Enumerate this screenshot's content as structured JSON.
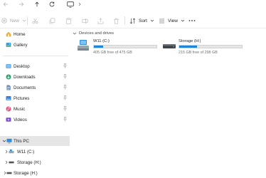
{
  "toolbar": {
    "new_label": "New",
    "sort_label": "Sort",
    "view_label": "View"
  },
  "sidebar": {
    "home": "Home",
    "gallery": "Gallery",
    "quick": [
      "Desktop",
      "Downloads",
      "Documents",
      "Pictures",
      "Music",
      "Videos"
    ],
    "this_pc": "This PC",
    "tree": [
      "W11 (C:)",
      "Storage (H:)",
      "Storage (H:)"
    ]
  },
  "content": {
    "group": "Devices and drives",
    "drives": [
      {
        "name": "W11 (C:)",
        "free": "405 GB free of 475 GB",
        "used_fraction": 0.15
      },
      {
        "name": "Storage (H:)",
        "free": "215 GB free of 298 GB",
        "used_fraction": 0.28
      }
    ]
  },
  "colors": {
    "accent": "#1f86d6",
    "selected": "#e5e5e5"
  },
  "icons": [
    "arrow-up-icon",
    "refresh-icon",
    "monitor-icon",
    "home-icon",
    "gallery-icon",
    "pin-icon",
    "drive-icon"
  ]
}
